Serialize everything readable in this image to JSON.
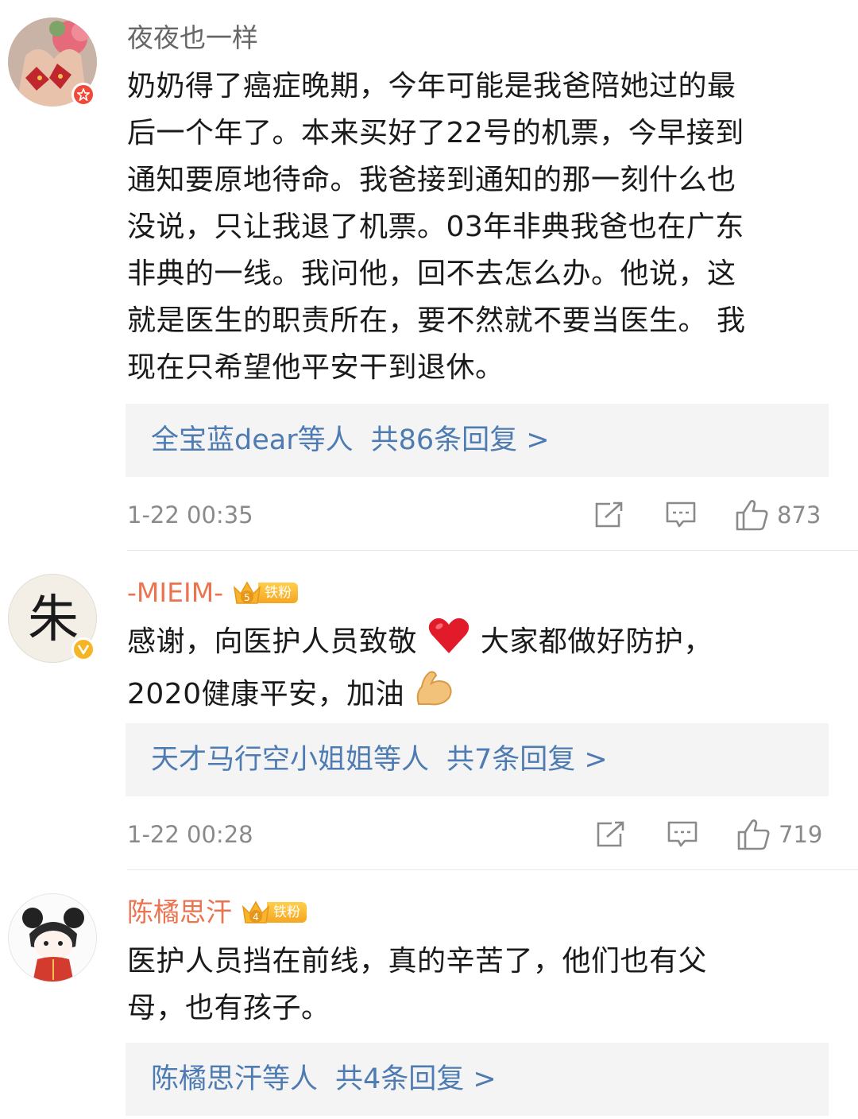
{
  "comments": [
    {
      "username": "夜夜也一样",
      "username_color": "#666666",
      "lines": [
        "奶奶得了癌症晚期，今年可能是我爸陪她过的最",
        "后一个年了。本来买好了22号的机票，今早接到",
        "通知要原地待命。我爸接到通知的那一刻什么也",
        "没说，只让我退了机票。03年非典我爸也在广东",
        "非典的一线。我问他，回不去怎么办。他说，这",
        "就是医生的职责所在，要不然就不要当医生。 我",
        "现在只希望他平安干到退休。"
      ],
      "reply_names": "全宝蓝dear等人",
      "reply_count": "共86条回复 >",
      "timestamp": "1-22 00:35",
      "likes": "873"
    },
    {
      "username": "-MIEIM-",
      "username_color": "#eb7350",
      "fan_badge": "铁粉",
      "fan_level": "5",
      "avatar_char": "朱",
      "lines_a": "感谢，向医护人员致敬",
      "lines_b": "大家都做好防护，",
      "line2": "2020健康平安，加油",
      "reply_names": "天才马行空小姐姐等人",
      "reply_count": "共7条回复 >",
      "timestamp": "1-22 00:28",
      "likes": "719"
    },
    {
      "username": "陈橘思汗",
      "username_color": "#eb7350",
      "fan_badge": "铁粉",
      "fan_level": "4",
      "lines": [
        "医护人员挡在前线，真的辛苦了，他们也有父",
        "母，也有孩子。"
      ],
      "reply_names": "陈橘思汗等人",
      "reply_count": "共4条回复 >"
    }
  ],
  "icons": {
    "share": "share-icon",
    "comment": "comment-icon",
    "like": "thumbs-up-icon",
    "heart": "red-heart-emoji",
    "muscle": "flexed-biceps-emoji",
    "verified_red": "red-star-badge-icon",
    "verified_yellow": "yellow-v-badge-icon"
  }
}
